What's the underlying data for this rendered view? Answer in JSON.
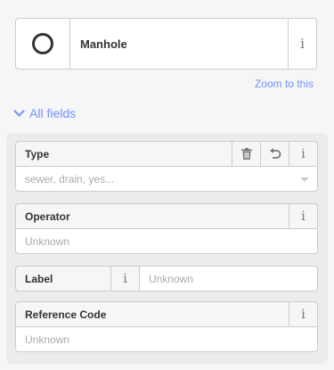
{
  "preset": {
    "name": "Manhole",
    "icon": "circle-outline-icon",
    "info_glyph": "i"
  },
  "zoom_link": "Zoom to this",
  "section": {
    "label": "All fields",
    "expanded": true
  },
  "fields": {
    "type": {
      "label": "Type",
      "placeholder": "sewer, drain, yes..."
    },
    "operator": {
      "label": "Operator",
      "placeholder": "Unknown"
    },
    "label": {
      "label": "Label",
      "placeholder": "Unknown"
    },
    "reference_code": {
      "label": "Reference Code",
      "placeholder": "Unknown"
    }
  },
  "colors": {
    "link": "#7092ff",
    "border": "#cccccc",
    "panel_bg": "#ececec"
  }
}
